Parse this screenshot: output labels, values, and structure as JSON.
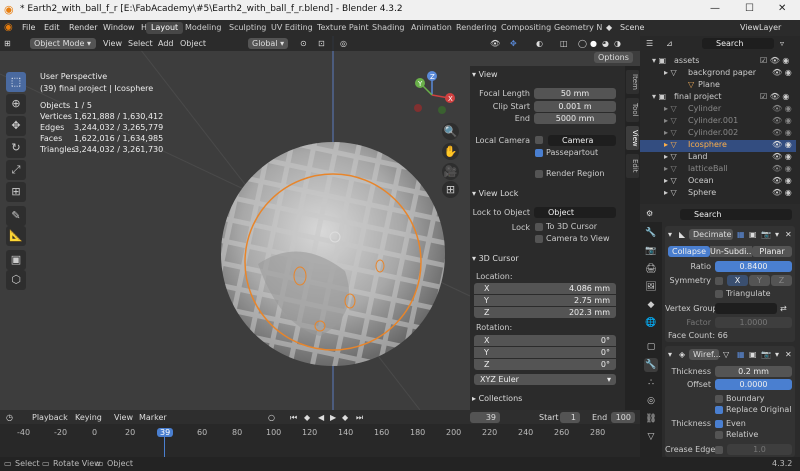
{
  "window": {
    "title": "* Earth2_with_ball_f_r [E:\\FabAcademy\\#5\\Earth2_with_ball_f_r.blend] - Blender 4.3.2",
    "min": "—",
    "max": "☐",
    "close": "✕"
  },
  "menu": [
    "File",
    "Edit",
    "Render",
    "Window",
    "Help"
  ],
  "workspaces": [
    "Layout",
    "Modeling",
    "Sculpting",
    "UV Editing",
    "Texture Paint",
    "Shading",
    "Animation",
    "Rendering",
    "Compositing",
    "Geometry N"
  ],
  "scene": {
    "label": "Scene",
    "viewlayer": "ViewLayer"
  },
  "viewport_header": {
    "mode": "Object Mode",
    "view": "View",
    "select": "Select",
    "add": "Add",
    "object": "Object",
    "orientation": "Global",
    "options": "Options"
  },
  "viewport_info": {
    "title": "User Perspective",
    "subtitle": "(39) final project | Icosphere",
    "stats": [
      {
        "label": "Objects",
        "value": "1 / 5"
      },
      {
        "label": "Vertices",
        "value": "1,621,888 / 1,630,412"
      },
      {
        "label": "Edges",
        "value": "3,244,032 / 3,265,779"
      },
      {
        "label": "Faces",
        "value": "1,622,016 / 1,634,985"
      },
      {
        "label": "Triangles",
        "value": "3,244,032 / 3,261,730"
      }
    ]
  },
  "gizmo": {
    "x": "X",
    "y": "Y",
    "z": "Z"
  },
  "npanel": {
    "tabs": [
      "Item",
      "Tool",
      "View",
      "Edit"
    ],
    "view_section": "View",
    "focal_length_label": "Focal Length",
    "focal_length": "50 mm",
    "clip_start_label": "Clip Start",
    "clip_start": "0.001 m",
    "end_label": "End",
    "end": "5000 mm",
    "local_camera_label": "Local Camera",
    "camera_placeholder": "Camera",
    "passepartout": "Passepartout",
    "render_region": "Render Region",
    "view_lock_section": "View Lock",
    "lock_to_object_label": "Lock to Object",
    "object_placeholder": "Object",
    "lock_label": "Lock",
    "lock_3d_cursor": "To 3D Cursor",
    "camera_to_view": "Camera to View",
    "cursor_section": "3D Cursor",
    "location_label": "Location:",
    "loc": [
      {
        "axis": "X",
        "value": "4.086 mm"
      },
      {
        "axis": "Y",
        "value": "2.75 mm"
      },
      {
        "axis": "Z",
        "value": "202.3 mm"
      }
    ],
    "rotation_label": "Rotation:",
    "rot": [
      {
        "axis": "X",
        "value": "0°"
      },
      {
        "axis": "Y",
        "value": "0°"
      },
      {
        "axis": "Z",
        "value": "0°"
      }
    ],
    "rotation_mode": "XYZ Euler",
    "collections_section": "Collections"
  },
  "timeline": {
    "playback": "Playback",
    "keying": "Keying",
    "view": "View",
    "marker": "Marker",
    "current_frame": "39",
    "start_label": "Start",
    "start": "1",
    "end_label": "End",
    "end": "100",
    "ticks": [
      "-40",
      "-20",
      "0",
      "20",
      "39",
      "60",
      "80",
      "100",
      "120",
      "140",
      "160",
      "180",
      "200",
      "220",
      "240",
      "260",
      "280"
    ]
  },
  "statusbar": {
    "select": "Select",
    "rotate": "Rotate View",
    "object": "Object",
    "version": "4.3.2"
  },
  "outliner": {
    "search_placeholder": "Search",
    "rows": [
      {
        "name": "assets",
        "level": 1
      },
      {
        "name": "backgrond paper",
        "level": 2
      },
      {
        "name": "Plane",
        "level": 3
      },
      {
        "name": "final project",
        "level": 1
      },
      {
        "name": "Cylinder",
        "level": 2
      },
      {
        "name": "Cylinder.001",
        "level": 2
      },
      {
        "name": "Cylinder.002",
        "level": 2
      },
      {
        "name": "Icosphere",
        "level": 2
      },
      {
        "name": "Land",
        "level": 2
      },
      {
        "name": "latticeBall",
        "level": 2
      },
      {
        "name": "Ocean",
        "level": 2
      },
      {
        "name": "Sphere",
        "level": 2
      }
    ]
  },
  "properties": {
    "search_placeholder": "Search",
    "decimate": {
      "name": "Decimate",
      "tabs": [
        "Collapse",
        "Un-Subdi...",
        "Planar"
      ],
      "ratio_label": "Ratio",
      "ratio": "0.8400",
      "symmetry_label": "Symmetry",
      "sym_axes": [
        "X",
        "Y",
        "Z"
      ],
      "triangulate": "Triangulate",
      "vertex_group_label": "Vertex Group",
      "factor_label": "Factor",
      "factor": "1.0000",
      "face_count": "Face Count: 66"
    },
    "wireframe": {
      "name": "Wiref...",
      "thickness_label": "Thickness",
      "thickness": "0.2 mm",
      "offset_label": "Offset",
      "offset": "0.0000",
      "boundary": "Boundary",
      "replace_original": "Replace Original",
      "thickness2_label": "Thickness",
      "even": "Even",
      "relative": "Relative",
      "crease_edges_label": "Crease Edges",
      "crease_value": "1.0"
    }
  },
  "colors": {
    "accent": "#4a7fd0",
    "selection_orange": "#e8852a",
    "active_tab": "#474747"
  }
}
